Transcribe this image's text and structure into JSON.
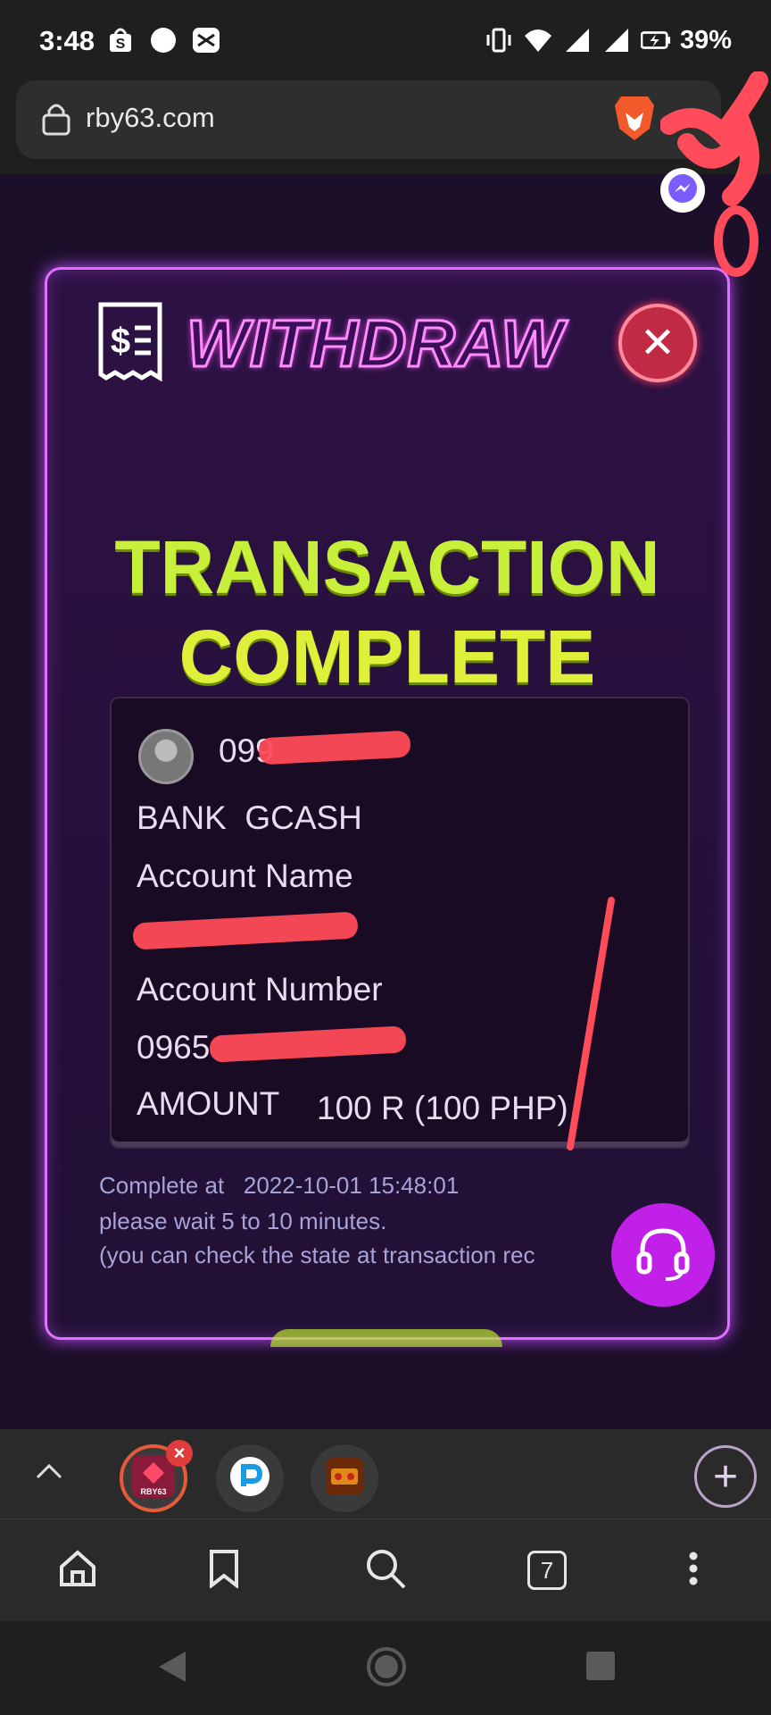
{
  "status_bar": {
    "time": "3:48",
    "battery": "39%",
    "icons": [
      "shopping-bag-icon",
      "circle-notification-icon",
      "capcut-icon",
      "vibrate-icon",
      "wifi-icon",
      "signal-icon",
      "signal-icon",
      "battery-charging-icon"
    ]
  },
  "browser": {
    "url": "rby63.com",
    "tabs_count": "7"
  },
  "modal": {
    "title": "WITHDRAW",
    "status_line1": "TRANSACTION",
    "status_line2": "COMPLETE",
    "card": {
      "phone_prefix": "099",
      "bank_label": "BANK",
      "bank_value": "GCASH",
      "account_name_label": "Account Name",
      "account_name_prefix": "",
      "account_number_label": "Account Number",
      "account_number_prefix": "0965",
      "amount_label": "AMOUNT",
      "amount_value": "100 R (100 PHP)"
    },
    "complete_label": "Complete at",
    "complete_time": "2022-10-01 15:48:01",
    "note1": "please wait 5 to 10 minutes.",
    "note2": "(you can check the state at transaction rec"
  },
  "colors": {
    "accent": "#e070ff",
    "title_green": "#c8f03a",
    "support": "#c020e8",
    "redaction": "#ff4b5a"
  }
}
